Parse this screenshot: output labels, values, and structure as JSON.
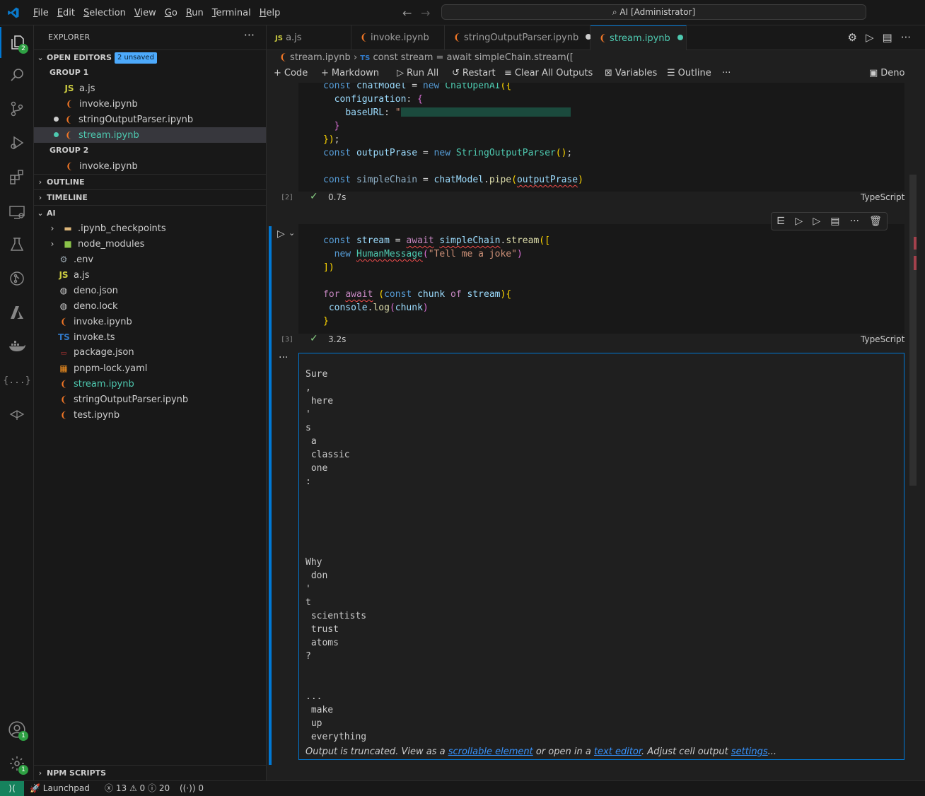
{
  "title_bar": {
    "menus": [
      "File",
      "Edit",
      "Selection",
      "View",
      "Go",
      "Run",
      "Terminal",
      "Help"
    ],
    "command_center": "AI [Administrator]"
  },
  "activity_bar": {
    "icons": [
      "files-icon",
      "search-icon",
      "source-control-icon",
      "run-debug-icon",
      "extensions-icon",
      "remote-explorer-icon",
      "testing-icon",
      "gitlens-icon",
      "azure-icon",
      "docker-icon",
      "json-icon",
      "chat-icon"
    ],
    "explorer_badge": "2",
    "accounts_badge": "1",
    "settings_badge": "1"
  },
  "sidebar": {
    "title": "EXPLORER",
    "more": "···",
    "open_editors": {
      "label": "OPEN EDITORS",
      "unsaved_badge": "2 unsaved",
      "group1_label": "GROUP 1",
      "group1": [
        "a.js",
        "invoke.ipynb",
        "stringOutputParser.ipynb",
        "stream.ipynb"
      ],
      "group2_label": "GROUP 2",
      "group2": [
        "invoke.ipynb"
      ]
    },
    "outline_label": "OUTLINE",
    "timeline_label": "TIMELINE",
    "folder_label": "AI",
    "files": [
      ".ipynb_checkpoints",
      "node_modules",
      ".env",
      "a.js",
      "deno.json",
      "deno.lock",
      "invoke.ipynb",
      "invoke.ts",
      "package.json",
      "pnpm-lock.yaml",
      "stream.ipynb",
      "stringOutputParser.ipynb",
      "test.ipynb"
    ],
    "npm_scripts_label": "NPM SCRIPTS"
  },
  "tabs": [
    "a.js",
    "invoke.ipynb",
    "stringOutputParser.ipynb",
    "stream.ipynb"
  ],
  "breadcrumbs": {
    "file": "stream.ipynb",
    "symbol": "const stream = await simpleChain.stream(["
  },
  "notebook_toolbar": {
    "code": "Code",
    "markdown": "Markdown",
    "run_all": "Run All",
    "restart": "Restart",
    "clear_outputs": "Clear All Outputs",
    "variables": "Variables",
    "outline": "Outline",
    "kernel": "Deno"
  },
  "cell2": {
    "exec": "[2]",
    "time": "0.7s",
    "lang": "TypeScript"
  },
  "cell3": {
    "exec": "[3]",
    "time": "3.2s",
    "lang": "TypeScript"
  },
  "output": {
    "lines": [
      "Sure",
      ",",
      " here",
      "'",
      "s",
      " a",
      " classic",
      " one",
      ":",
      "",
      "",
      "",
      "",
      "",
      "Why",
      " don",
      "'",
      "t",
      " scientists",
      " trust",
      " atoms",
      "?",
      "",
      "",
      "...",
      " make",
      " up",
      " everything"
    ],
    "trunc_1": "Output is truncated. View as a ",
    "trunc_link1": "scrollable element",
    "trunc_2": " or open in a ",
    "trunc_link2": "text editor",
    "trunc_3": ". Adjust cell output ",
    "trunc_link3": "settings",
    "trunc_4": "..."
  },
  "status_bar": {
    "launchpad": "Launchpad",
    "errors": "13",
    "warnings": "0",
    "infos": "20",
    "ports": "0"
  }
}
